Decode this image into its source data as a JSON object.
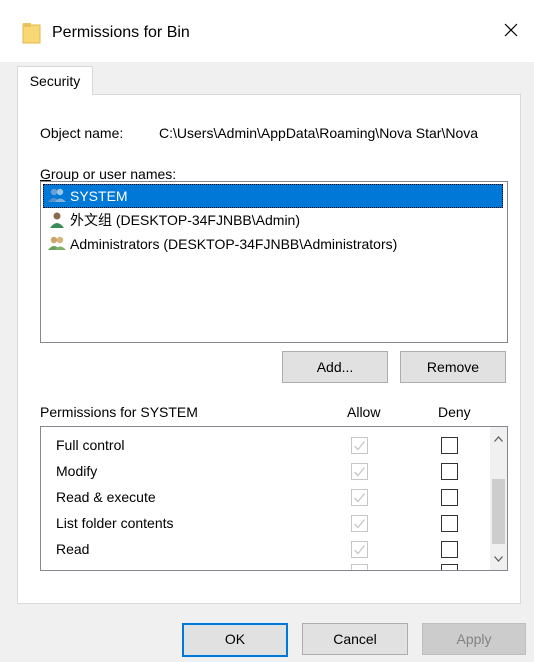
{
  "window": {
    "title": "Permissions for Bin"
  },
  "tabs": [
    {
      "label": "Security"
    }
  ],
  "object": {
    "label": "Object name:",
    "value": "C:\\Users\\Admin\\AppData\\Roaming\\Nova Star\\Nova"
  },
  "groups": {
    "label": "Group or user names:",
    "items": [
      {
        "name": "SYSTEM",
        "icon": "users-icon"
      },
      {
        "name": "外文组 (DESKTOP-34FJNBB\\Admin)",
        "icon": "user-icon"
      },
      {
        "name": "Administrators (DESKTOP-34FJNBB\\Administrators)",
        "icon": "users-icon"
      }
    ],
    "selected_index": 0
  },
  "buttons": {
    "add": "Add...",
    "remove": "Remove",
    "ok": "OK",
    "cancel": "Cancel",
    "apply": "Apply"
  },
  "permissions": {
    "label": "Permissions for SYSTEM",
    "allow_header": "Allow",
    "deny_header": "Deny",
    "rows": [
      {
        "name": "Full control",
        "allow": true,
        "deny": false
      },
      {
        "name": "Modify",
        "allow": true,
        "deny": false
      },
      {
        "name": "Read & execute",
        "allow": true,
        "deny": false
      },
      {
        "name": "List folder contents",
        "allow": true,
        "deny": false
      },
      {
        "name": "Read",
        "allow": true,
        "deny": false
      }
    ]
  },
  "colors": {
    "selection": "#0078d7",
    "folder": "#f8d775",
    "default_button_border": "#0078d7"
  }
}
